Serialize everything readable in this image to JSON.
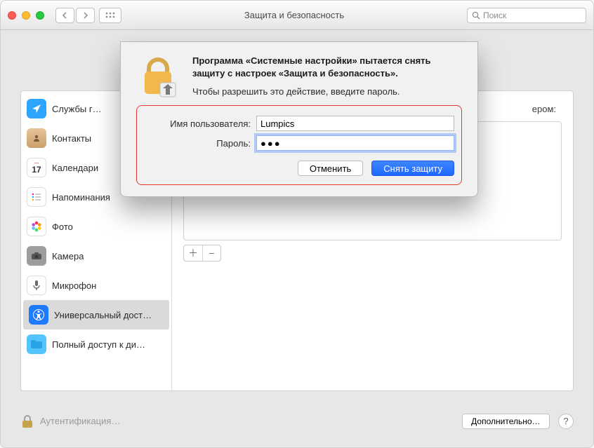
{
  "window": {
    "title": "Защита и безопасность",
    "search_placeholder": "Поиск"
  },
  "sidebar": {
    "items": [
      {
        "label": "Службы г…",
        "icon": "location",
        "bg": "#2da5ff"
      },
      {
        "label": "Контакты",
        "icon": "contacts",
        "bg": "#d7a268"
      },
      {
        "label": "Календари",
        "icon": "calendar",
        "bg": "#ffffff"
      },
      {
        "label": "Напоминания",
        "icon": "reminders",
        "bg": "#ffffff"
      },
      {
        "label": "Фото",
        "icon": "photos",
        "bg": "#ffffff"
      },
      {
        "label": "Камера",
        "icon": "camera",
        "bg": "#9d9d9d"
      },
      {
        "label": "Микрофон",
        "icon": "microphone",
        "bg": "#ffffff"
      },
      {
        "label": "Универсальный дост…",
        "icon": "accessibility",
        "bg": "#1e7bff",
        "selected": true
      },
      {
        "label": "Полный доступ к ди…",
        "icon": "folder",
        "bg": "#53c4ff"
      }
    ]
  },
  "main": {
    "hint_suffix": "ером:"
  },
  "footer": {
    "auth_label": "Аутентификация…",
    "advanced_label": "Дополнительно…"
  },
  "dialog": {
    "heading": "Программа «Системные настройки» пытается снять защиту с настроек «Защита и безопасность».",
    "sub": "Чтобы разрешить это действие, введите пароль.",
    "user_label": "Имя пользователя:",
    "user_value": "Lumpics",
    "pass_label": "Пароль:",
    "pass_value": "●●●",
    "cancel": "Отменить",
    "unlock": "Снять защиту"
  },
  "icons": {
    "calendar_day": "17"
  }
}
